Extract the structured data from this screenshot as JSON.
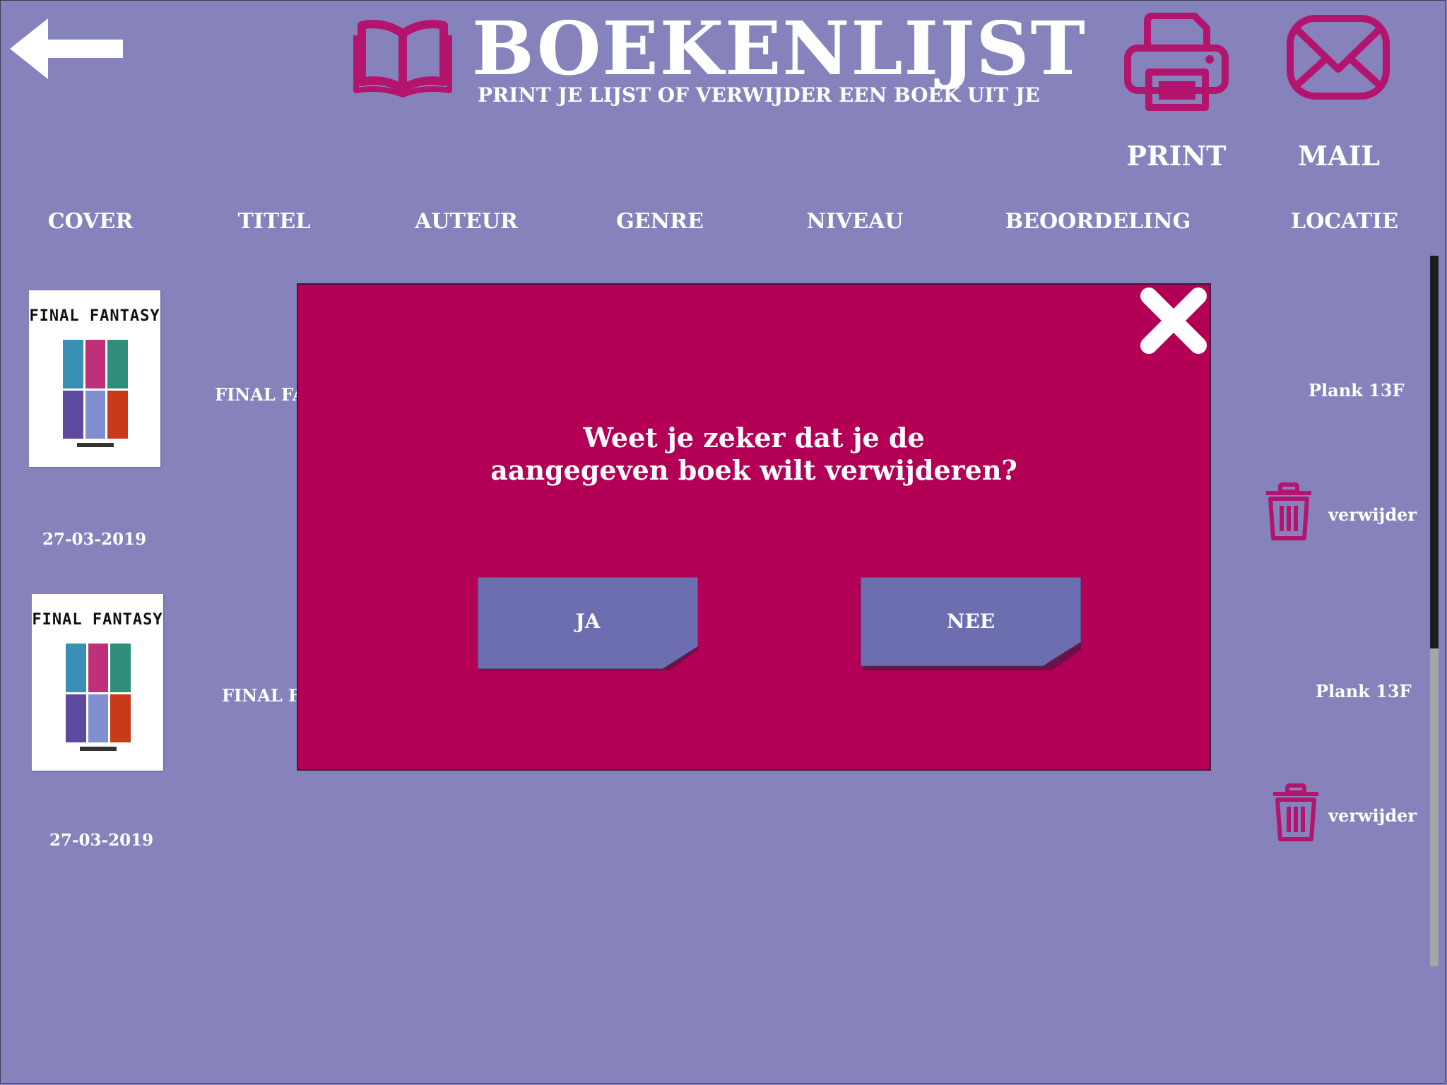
{
  "header": {
    "title": "BOEKENLIJST",
    "subtitle": "PRINT JE LIJST OF VERWIJDER EEN BOEK UIT JE",
    "back_icon": "arrow-left-icon",
    "logo_icon": "open-book-icon"
  },
  "actions": {
    "print_label": "PRINT",
    "mail_label": "MAIL",
    "print_icon": "printer-icon",
    "mail_icon": "envelope-icon"
  },
  "columns": [
    "COVER",
    "TITEL",
    "AUTEUR",
    "GENRE",
    "NIVEAU",
    "BEOORDELING",
    "LOCATIE"
  ],
  "books": [
    {
      "cover_text": "FINAL FANTASY",
      "date": "27-03-2019",
      "title": "FINAL FAN",
      "location": "Plank  13F",
      "delete_label": "verwijder"
    },
    {
      "cover_text": "FINAL FANTASY",
      "date": "27-03-2019",
      "title": "FINAL FA",
      "location": "Plank  13F",
      "delete_label": "verwijder"
    }
  ],
  "dialog": {
    "message_line1": "Weet je zeker dat je de",
    "message_line2": "aangegeven boek wilt verwijderen?",
    "yes_label": "JA",
    "no_label": "NEE",
    "close_icon": "close-x-icon"
  },
  "colors": {
    "background": "#8683bc",
    "accent": "#b3146e",
    "dialog": "#b30056",
    "button": "#6d6eb0",
    "text": "#ffffff"
  }
}
